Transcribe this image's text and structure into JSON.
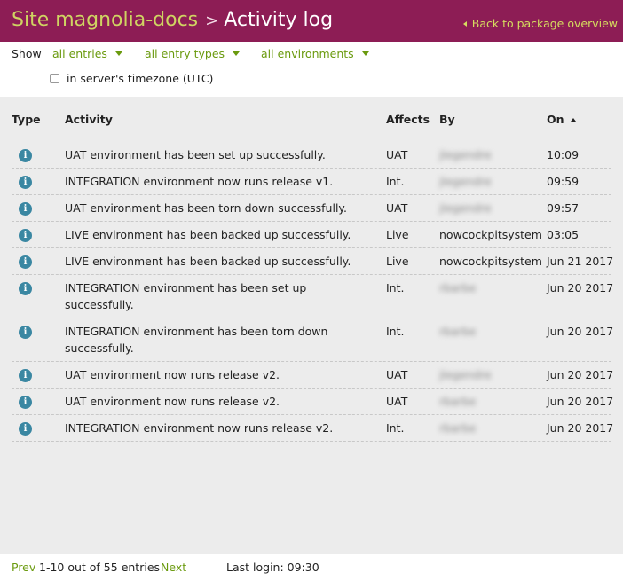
{
  "header": {
    "site": "Site magnolia-docs",
    "separator": ">",
    "page": "Activity log",
    "back": "Back to package overview"
  },
  "filters": {
    "show": "Show",
    "entries": "all entries",
    "types": "all entry types",
    "environments": "all environments",
    "timezone": "in server's timezone (UTC)"
  },
  "columns": {
    "type": "Type",
    "activity": "Activity",
    "affects": "Affects",
    "by": "By",
    "on": "On"
  },
  "rows": [
    {
      "activity": "UAT environment has been set up successfully.",
      "affects": "UAT",
      "by": "jlegendre",
      "on": "10:09"
    },
    {
      "activity": "INTEGRATION environment now runs release v1.",
      "affects": "Int.",
      "by": "jlegendre",
      "on": "09:59"
    },
    {
      "activity": "UAT environment has been torn down successfully.",
      "affects": "UAT",
      "by": "jlegendre",
      "on": "09:57"
    },
    {
      "activity": "LIVE environment has been backed up successfully.",
      "affects": "Live",
      "by": "nowcockpitsystem",
      "on": "03:05"
    },
    {
      "activity": "LIVE environment has been backed up successfully.",
      "affects": "Live",
      "by": "nowcockpitsystem",
      "on": "Jun 21 2017"
    },
    {
      "activity": "INTEGRATION environment has been set up successfully.",
      "affects": "Int.",
      "by": "rbarbe",
      "on": "Jun 20 2017"
    },
    {
      "activity": "INTEGRATION environment has been torn down successfully.",
      "affects": "Int.",
      "by": "rbarbe",
      "on": "Jun 20 2017"
    },
    {
      "activity": "UAT environment now runs release v2.",
      "affects": "UAT",
      "by": "jlegendre",
      "on": "Jun 20 2017"
    },
    {
      "activity": "UAT environment now runs release v2.",
      "affects": "UAT",
      "by": "rbarbe",
      "on": "Jun 20 2017"
    },
    {
      "activity": "INTEGRATION environment now runs release v2.",
      "affects": "Int.",
      "by": "rbarbe",
      "on": "Jun 20 2017"
    }
  ],
  "footer": {
    "prev": "Prev",
    "count": "1-10 out of 55 entries",
    "next": "Next",
    "last_login": "Last login: 09:30"
  },
  "colors": {
    "header_bg": "#8d1d55",
    "site_text": "#cfd462",
    "link_green": "#6a9a0e",
    "info_icon": "#3a87a2"
  }
}
